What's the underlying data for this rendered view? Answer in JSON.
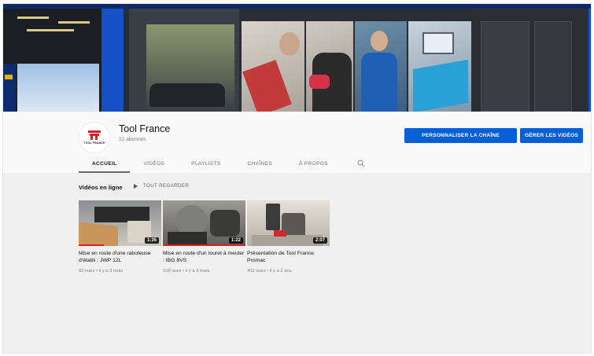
{
  "channel": {
    "name": "Tool France",
    "subscribers": "12 abonnés",
    "avatar_brand": "TOOL FRANCE",
    "brand_color": "#d71f26"
  },
  "buttons": {
    "customize": "PERSONNALISER LA CHAÎNE",
    "manage": "GÉRER LES VIDÉOS",
    "color": "#065fd4"
  },
  "tabs": [
    {
      "label": "ACCUEIL",
      "active": true
    },
    {
      "label": "VIDÉOS",
      "active": false
    },
    {
      "label": "PLAYLISTS",
      "active": false
    },
    {
      "label": "CHAÎNES",
      "active": false
    },
    {
      "label": "À PROPOS",
      "active": false
    }
  ],
  "tab_search_icon": "search-icon",
  "section": {
    "title": "Vidéos en ligne",
    "play_all": "TOUT REGARDER",
    "play_icon": "play-icon"
  },
  "videos": [
    {
      "title": "Mise en route d'une raboteuse d'établi : JWP 12L",
      "duration": "1:35",
      "meta": "92 vues • il y a 3 mois",
      "watched_progress": 0.3
    },
    {
      "title": "Mise en route d'un touret à meuler : IBG 8VS",
      "duration": "1:22",
      "meta": "100 vues • il y a 3 mois",
      "watched_progress": 1.0
    },
    {
      "title": "Présentation de Tool France Promac",
      "duration": "2:07",
      "meta": "402 vues • il y a 2 ans",
      "watched_progress": 0
    }
  ]
}
